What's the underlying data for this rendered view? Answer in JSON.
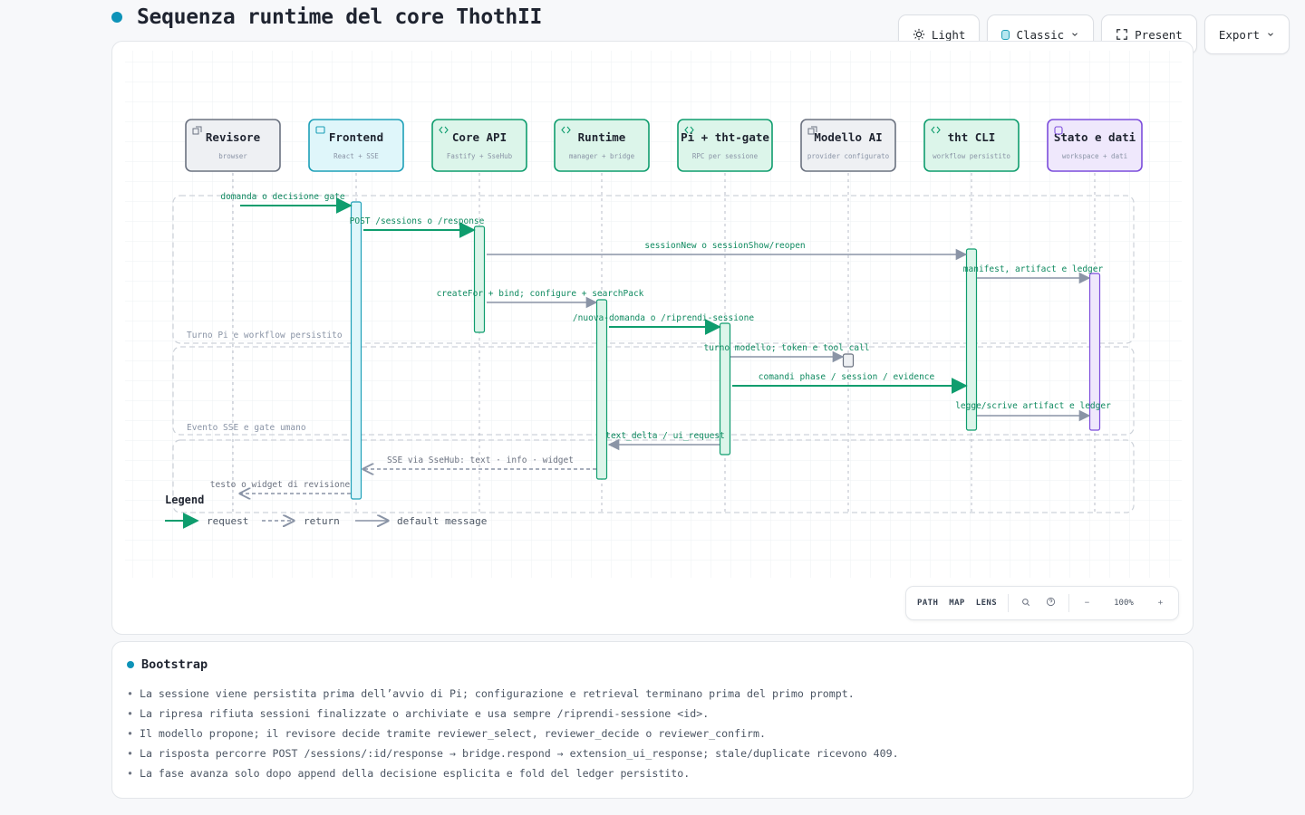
{
  "page": {
    "title": "Sequenza runtime del core ThothII"
  },
  "toolbar": {
    "theme_label": "Light",
    "style_label": "Classic",
    "present_label": "Present",
    "export_label": "Export"
  },
  "diagram": {
    "participants": [
      {
        "id": "revisore",
        "name": "Revisore",
        "sub": "browser",
        "kind": "gray",
        "icon": "external-icon"
      },
      {
        "id": "frontend",
        "name": "Frontend",
        "sub": "React + SSE",
        "kind": "cyan",
        "icon": "window-icon"
      },
      {
        "id": "core",
        "name": "Core API",
        "sub": "Fastify + SseHub",
        "kind": "green",
        "icon": "code-icon"
      },
      {
        "id": "runtime",
        "name": "Runtime",
        "sub": "manager + bridge",
        "kind": "green",
        "icon": "code-icon"
      },
      {
        "id": "pi",
        "name": "Pi + tht-gate",
        "sub": "RPC per sessione",
        "kind": "green",
        "icon": "code-icon"
      },
      {
        "id": "modello",
        "name": "Modello AI",
        "sub": "provider configurato",
        "kind": "gray",
        "icon": "external-icon"
      },
      {
        "id": "cli",
        "name": "tht CLI",
        "sub": "workflow persistito",
        "kind": "green",
        "icon": "code-icon"
      },
      {
        "id": "stato",
        "name": "Stato e dati",
        "sub": "workspace + dati",
        "kind": "purple",
        "icon": "database-icon"
      }
    ],
    "groups": [
      {
        "label": "Turno Pi e workflow persistito"
      },
      {
        "label": "Evento SSE e gate umano"
      },
      {
        "label": ""
      }
    ],
    "messages": [
      {
        "from": 0,
        "to": 1,
        "label": "domanda o decisione gate",
        "style": "request"
      },
      {
        "from": 1,
        "to": 2,
        "label": "POST /sessions o /response",
        "style": "request"
      },
      {
        "from": 2,
        "to": 6,
        "label": "sessionNew o sessionShow/reopen",
        "style": "default"
      },
      {
        "from": 6,
        "to": 7,
        "label": "manifest, artifact e ledger",
        "style": "default"
      },
      {
        "from": 2,
        "to": 3,
        "label": "createFor + bind; configure + searchPack",
        "style": "default"
      },
      {
        "from": 3,
        "to": 4,
        "label": "/nuova-domanda o /riprendi-sessione",
        "style": "request"
      },
      {
        "from": 4,
        "to": 5,
        "label": "turno modello; token e tool call",
        "style": "default"
      },
      {
        "from": 4,
        "to": 6,
        "label": "comandi phase / session / evidence",
        "style": "request"
      },
      {
        "from": 6,
        "to": 7,
        "label": "legge/scrive artifact e ledger",
        "style": "default"
      },
      {
        "from": 4,
        "to": 3,
        "label": "text_delta / ui_request",
        "style": "default"
      },
      {
        "from": 3,
        "to": 1,
        "label": "SSE via SseHub: text · info · widget",
        "style": "return"
      },
      {
        "from": 1,
        "to": 0,
        "label": "testo o widget di revisione",
        "style": "return"
      }
    ],
    "legend": {
      "title": "Legend",
      "request": "request",
      "return": "return",
      "default": "default message"
    },
    "colors": {
      "green": "#0f9d6e",
      "gray_arrow": "#8a94a6",
      "cyan": "#1ea0b8",
      "purple": "#7c4ddb"
    }
  },
  "zoom": {
    "path_label": "PATH",
    "map_label": "MAP",
    "lens_label": "LENS",
    "zoom_out": "−",
    "zoom_in": "+",
    "level": "100%"
  },
  "notes": {
    "title": "Bootstrap",
    "items": [
      "La sessione viene persistita prima dell’avvio di Pi; configurazione e retrieval terminano prima del primo prompt.",
      "La ripresa rifiuta sessioni finalizzate o archiviate e usa sempre /riprendi-sessione <id>.",
      "Il modello propone; il revisore decide tramite reviewer_select, reviewer_decide o reviewer_confirm.",
      "La risposta percorre POST /sessions/:id/response → bridge.respond → extension_ui_response; stale/duplicate ricevono 409.",
      "La fase avanza solo dopo append della decisione esplicita e fold del ledger persistito."
    ]
  }
}
